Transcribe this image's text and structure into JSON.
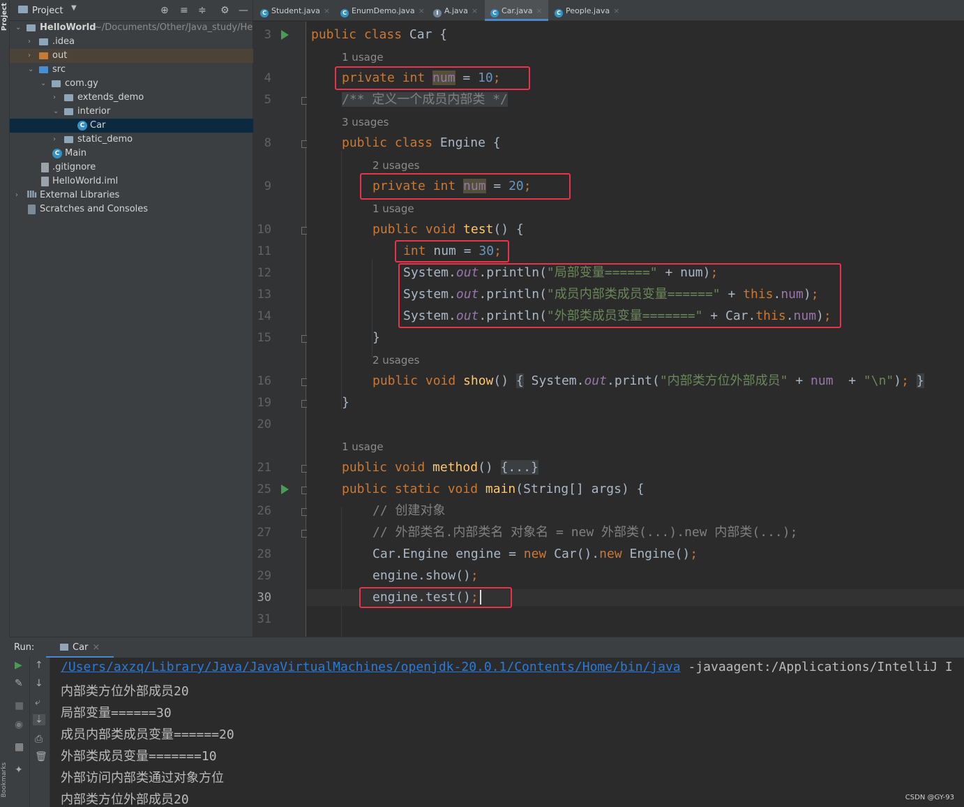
{
  "project_panel": {
    "title": "Project",
    "strip_label": "Project",
    "bookmarks_label": "Bookmarks",
    "tree": [
      {
        "label": "HelloWorld",
        "path": "~/Documents/Other/Java_study/Hello",
        "kind": "module"
      },
      {
        "label": ".idea",
        "kind": "folder"
      },
      {
        "label": "out",
        "kind": "folder-orange"
      },
      {
        "label": "src",
        "kind": "folder-src"
      },
      {
        "label": "com.gy",
        "kind": "package"
      },
      {
        "label": "extends_demo",
        "kind": "package"
      },
      {
        "label": "interior",
        "kind": "package"
      },
      {
        "label": "Car",
        "kind": "class"
      },
      {
        "label": "static_demo",
        "kind": "package"
      },
      {
        "label": "Main",
        "kind": "class"
      },
      {
        "label": ".gitignore",
        "kind": "file"
      },
      {
        "label": "HelloWorld.iml",
        "kind": "file"
      },
      {
        "label": "External Libraries",
        "kind": "libraries"
      },
      {
        "label": "Scratches and Consoles",
        "kind": "scratches"
      }
    ]
  },
  "tabs": [
    {
      "label": "Student.java",
      "active": false
    },
    {
      "label": "EnumDemo.java",
      "active": false
    },
    {
      "label": "A.java",
      "active": false
    },
    {
      "label": "Car.java",
      "active": true
    },
    {
      "label": "People.java",
      "active": false
    }
  ],
  "editor": {
    "line_numbers": [
      "3",
      "4",
      "5",
      "8",
      "9",
      "10",
      "11",
      "12",
      "13",
      "14",
      "15",
      "16",
      "19",
      "20",
      "21",
      "25",
      "26",
      "27",
      "28",
      "29",
      "30",
      "31"
    ],
    "hints": {
      "h1": "1 usage",
      "h2": "3 usages",
      "h3": "2 usages",
      "h4": "1 usage",
      "h5": "2 usages",
      "h6": "1 usage"
    },
    "code": {
      "l3": "public class Car {",
      "l4": "private int num = 10;",
      "l5": "/** 定义一个成员内部类 */",
      "l8": "public class Engine {",
      "l9": "private int num = 20;",
      "l10": "public void test() {",
      "l11": "int num = 30;",
      "l12": "System.out.println(\"局部变量======\" + num);",
      "l13": "System.out.println(\"成员内部类成员变量======\" + this.num);",
      "l14": "System.out.println(\"外部类成员变量=======\" + Car.this.num);",
      "l15": "}",
      "l16": "public void show() { System.out.print(\"内部类方位外部成员\" + num  + \"\\n\"); }",
      "l19": "}",
      "l21": "public void method() {...}",
      "l25": "public static void main(String[] args) {",
      "l26": "// 创建对象",
      "l27": "// 外部类名.内部类名 对象名 = new 外部类(...).new 内部类(...);",
      "l28": "Car.Engine engine = new Car().new Engine();",
      "l29": "engine.show();",
      "l30": "engine.test();"
    }
  },
  "run_panel": {
    "label": "Run:",
    "tab": "Car",
    "output": {
      "cmd_path": "/Users/axzq/Library/Java/JavaVirtualMachines/openjdk-20.0.1/Contents/Home/bin/java",
      "cmd_rest": " -javaagent:/Applications/IntelliJ I",
      "lines": [
        "内部类方位外部成员20",
        "局部变量======30",
        "成员内部类成员变量======20",
        "外部类成员变量=======10",
        "外部访问内部类通过对象方位",
        "内部类方位外部成员20"
      ]
    }
  },
  "watermark": "CSDN @GY-93",
  "colors": {
    "keyword": "#cc7832",
    "number": "#6897bb",
    "field": "#9876aa",
    "string": "#6a8759",
    "function": "#ffc66d",
    "highlight_box": "#e8334a",
    "link": "#287bde"
  }
}
